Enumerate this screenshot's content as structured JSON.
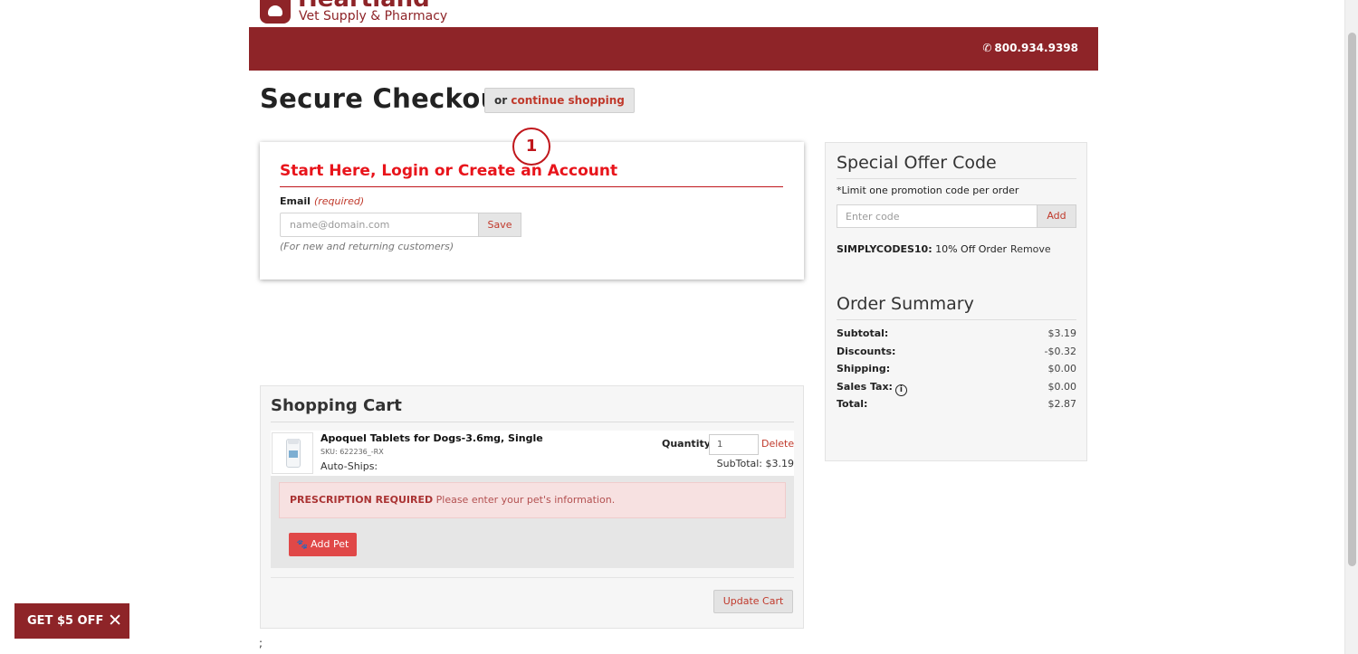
{
  "brand": {
    "name": "Heartland",
    "tagline": "Vet Supply & Pharmacy",
    "accent": "#8e2428"
  },
  "header": {
    "phone": "800.934.9398",
    "phone_icon": "phone-icon"
  },
  "page": {
    "title": "Secure Checkout",
    "continue_prefix": "or",
    "continue_link": "continue shopping"
  },
  "login": {
    "step_number": "1",
    "heading": "Start Here, Login or Create an Account",
    "email_label": "Email",
    "email_required": "(required)",
    "email_placeholder": "name@domain.com",
    "save_label": "Save",
    "help_text": "(For new and returning customers)"
  },
  "cart": {
    "title": "Shopping Cart",
    "item": {
      "name": "Apoquel Tablets for Dogs-3.6mg, Single",
      "sku": "SKU: 622236_-RX",
      "autoship": "Auto-Ships:",
      "quantity_label": "Quantity",
      "quantity_value": "1",
      "delete_label": "Delete",
      "subtotal": "SubTotal: $3.19"
    },
    "rx_alert_strong": "PRESCRIPTION REQUIRED",
    "rx_alert_text": "Please enter your pet's information.",
    "add_pet_label": "Add Pet",
    "update_label": "Update Cart"
  },
  "footer_fragment": ";",
  "offer": {
    "heading": "Special Offer Code",
    "note": "*Limit one promotion code per order",
    "input_placeholder": "Enter code",
    "add_label": "Add",
    "applied_code": "SIMPLYCODES10:",
    "applied_desc": "10% Off Order",
    "remove_label": "Remove"
  },
  "summary": {
    "heading": "Order Summary",
    "rows": [
      {
        "label": "Subtotal:",
        "value": "$3.19"
      },
      {
        "label": "Discounts:",
        "value": "-$0.32"
      },
      {
        "label": "Shipping:",
        "value": "$0.00"
      },
      {
        "label": "Sales Tax:",
        "value": "$0.00"
      },
      {
        "label": "Total:",
        "value": "$2.87"
      }
    ]
  },
  "promo_tab": {
    "label": "GET $5 OFF",
    "close": "✕"
  }
}
